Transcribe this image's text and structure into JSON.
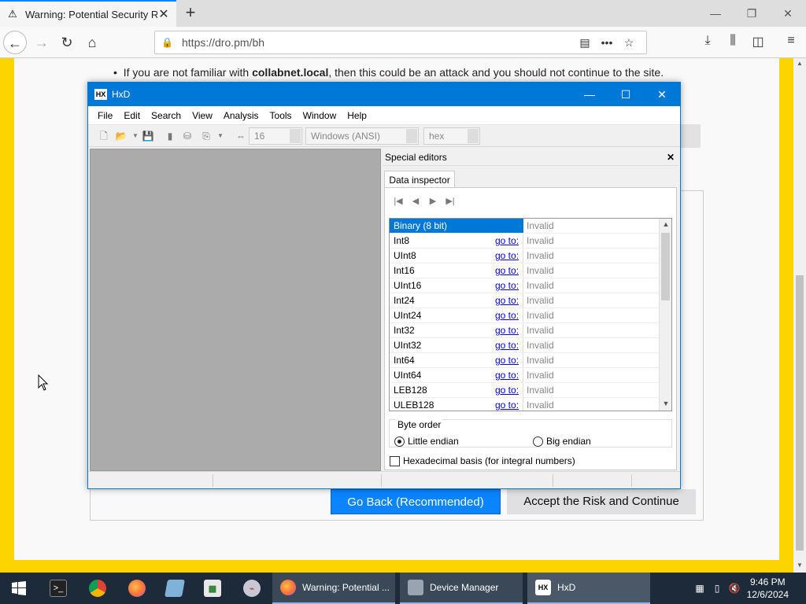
{
  "browser": {
    "tab_title": "Warning: Potential Security Ris",
    "url": "https://dro.pm/bh"
  },
  "page": {
    "bullet_prefix": "If you are not familiar with ",
    "bullet_host": "collabnet.local",
    "bullet_suffix": ", then this could be an attack and you should not continue to the site.",
    "go_back_label": "Go Back (Recommended)",
    "accept_label": "Accept the Risk and Continue"
  },
  "hxd": {
    "title": "HxD",
    "menu": [
      "File",
      "Edit",
      "Search",
      "View",
      "Analysis",
      "Tools",
      "Window",
      "Help"
    ],
    "bytes_per_row": "16",
    "charset": "Windows (ANSI)",
    "offset_base": "hex",
    "special_editors_title": "Special editors",
    "data_inspector_tab": "Data inspector",
    "inspector_rows": [
      {
        "type": "Binary (8 bit)",
        "goto": "",
        "value": "Invalid"
      },
      {
        "type": "Int8",
        "goto": "go to:",
        "value": "Invalid"
      },
      {
        "type": "UInt8",
        "goto": "go to:",
        "value": "Invalid"
      },
      {
        "type": "Int16",
        "goto": "go to:",
        "value": "Invalid"
      },
      {
        "type": "UInt16",
        "goto": "go to:",
        "value": "Invalid"
      },
      {
        "type": "Int24",
        "goto": "go to:",
        "value": "Invalid"
      },
      {
        "type": "UInt24",
        "goto": "go to:",
        "value": "Invalid"
      },
      {
        "type": "Int32",
        "goto": "go to:",
        "value": "Invalid"
      },
      {
        "type": "UInt32",
        "goto": "go to:",
        "value": "Invalid"
      },
      {
        "type": "Int64",
        "goto": "go to:",
        "value": "Invalid"
      },
      {
        "type": "UInt64",
        "goto": "go to:",
        "value": "Invalid"
      },
      {
        "type": "LEB128",
        "goto": "go to:",
        "value": "Invalid"
      },
      {
        "type": "ULEB128",
        "goto": "go to:",
        "value": "Invalid"
      }
    ],
    "byte_order_label": "Byte order",
    "little_endian": "Little endian",
    "big_endian": "Big endian",
    "hex_basis_label": "Hexadecimal basis (for integral numbers)"
  },
  "taskbar": {
    "apps": [
      {
        "label": "Warning: Potential ..."
      },
      {
        "label": "Device Manager"
      },
      {
        "label": "HxD"
      }
    ],
    "time": "9:46 PM",
    "date": "12/6/2024"
  }
}
